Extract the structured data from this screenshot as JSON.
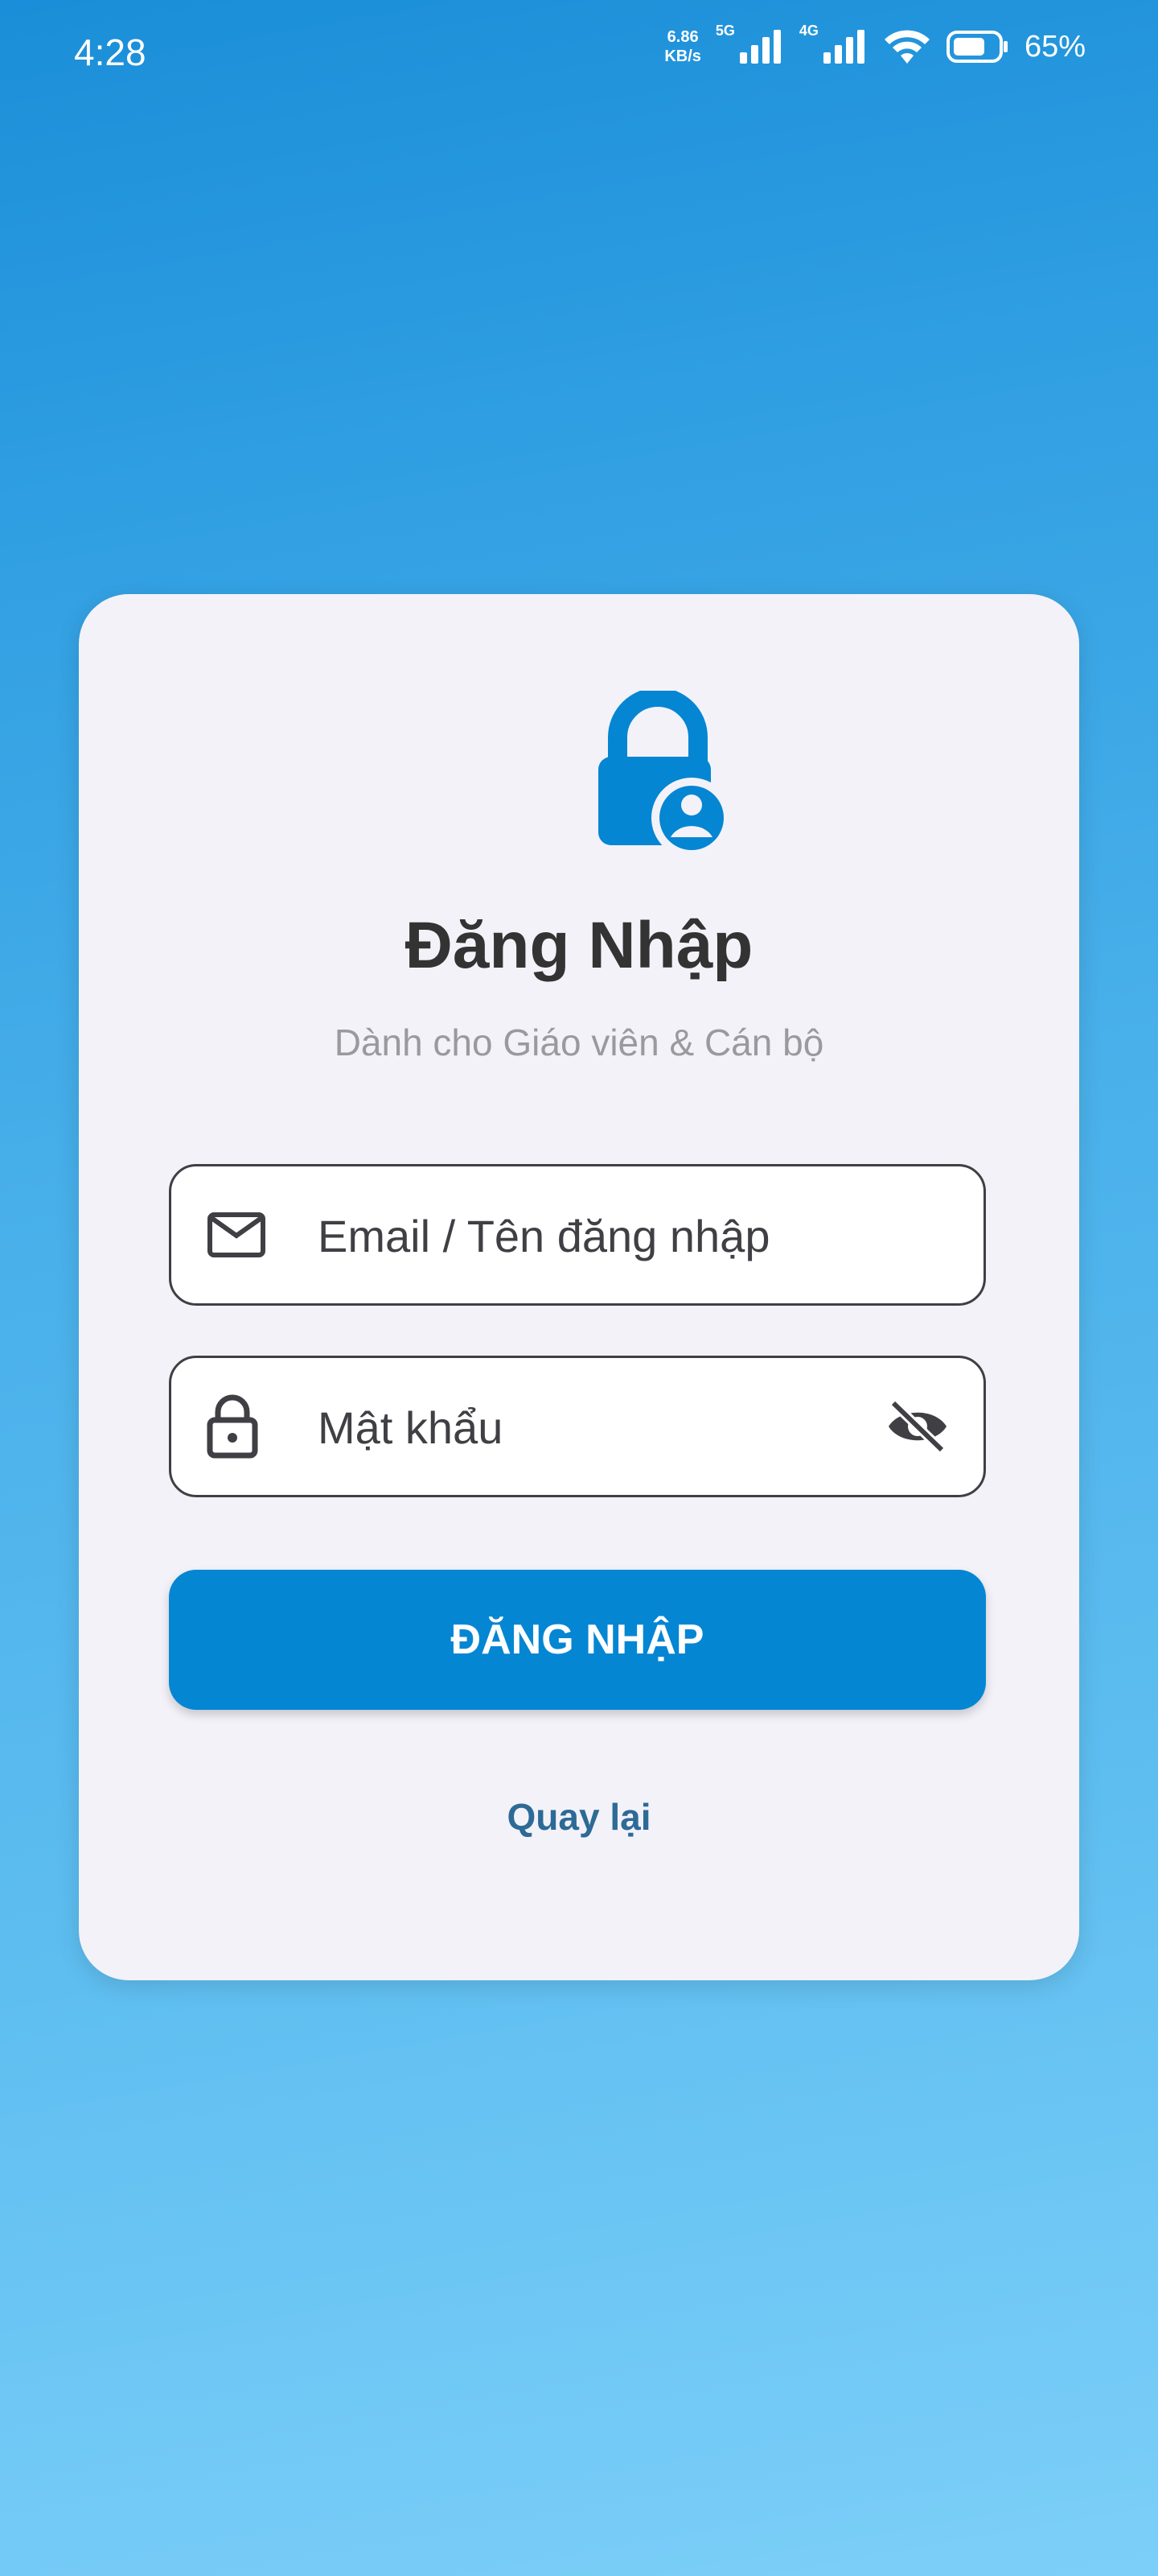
{
  "status_bar": {
    "time": "4:28",
    "net_speed_value": "6.86",
    "net_speed_unit": "KB/s",
    "signal1_label": "5G",
    "signal2_label": "4G",
    "battery_percent": "65%"
  },
  "login_card": {
    "title": "Đăng Nhập",
    "subtitle": "Dành cho Giáo viên & Cán bộ",
    "email_field": {
      "placeholder": "Email / Tên đăng nhập",
      "value": ""
    },
    "password_field": {
      "placeholder": "Mật khẩu",
      "value": ""
    },
    "login_button_label": "ĐĂNG NHẬP",
    "back_link_label": "Quay lại"
  },
  "icons": {
    "logo": "lock-user-icon",
    "email": "mail-icon",
    "password": "lock-icon",
    "visibility_toggle": "eye-off-icon"
  },
  "colors": {
    "primary": "#0586d3",
    "card_background": "#f3f2f9",
    "title": "#333333",
    "subtitle": "#9a9a9e",
    "link": "#2d6a96"
  }
}
